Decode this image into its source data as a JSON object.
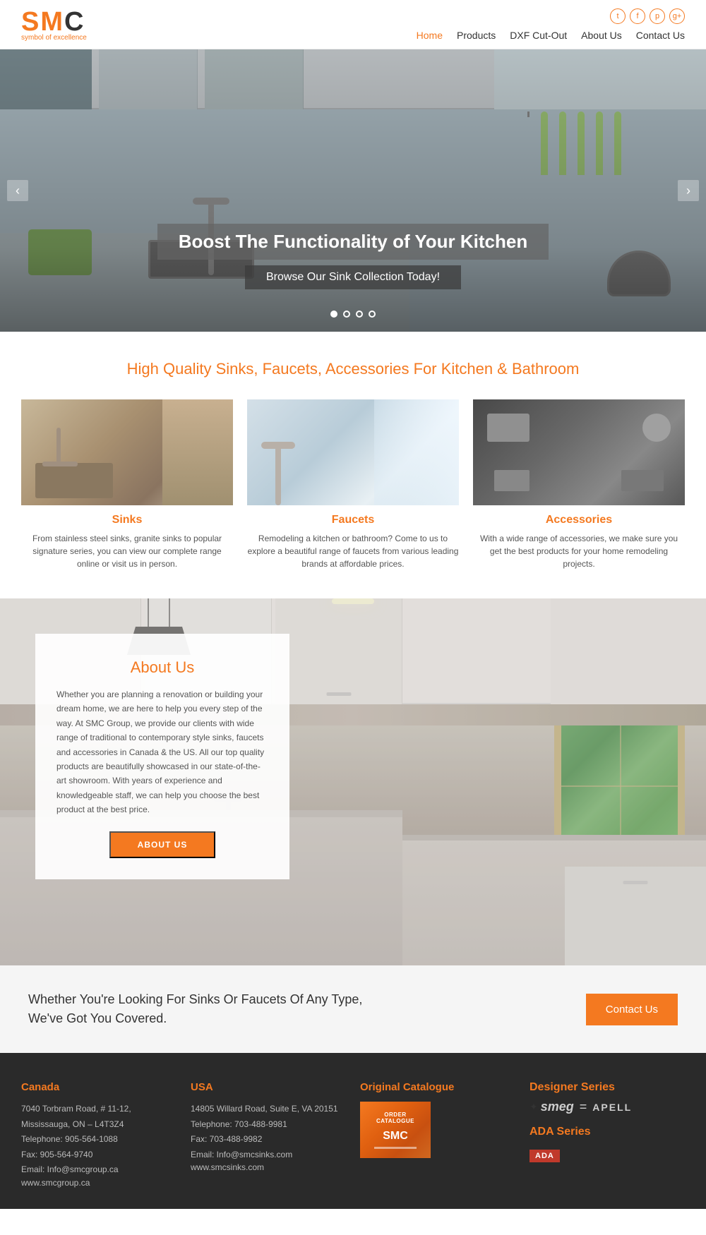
{
  "header": {
    "logo": {
      "main": "SMC",
      "sub": "symbol of excellence"
    },
    "social": {
      "twitter": "t",
      "facebook": "f",
      "pinterest": "p",
      "google": "g+"
    },
    "nav": [
      {
        "label": "Home",
        "active": true
      },
      {
        "label": "Products",
        "active": false
      },
      {
        "label": "DXF Cut-Out",
        "active": false
      },
      {
        "label": "About Us",
        "active": false
      },
      {
        "label": "Contact Us",
        "active": false
      }
    ]
  },
  "hero": {
    "title": "Boost The Functionality of Your Kitchen",
    "subtitle": "Browse Our Sink Collection Today!",
    "dots": [
      true,
      false,
      false,
      false
    ],
    "arrow_left": "‹",
    "arrow_right": "›"
  },
  "quality": {
    "title": "High Quality Sinks, Faucets, Accessories For Kitchen & Bathroom",
    "products": [
      {
        "name": "Sinks",
        "description": "From stainless steel sinks, granite sinks to popular signature series, you can view our complete range online or visit us in person.",
        "image_type": "sinks"
      },
      {
        "name": "Faucets",
        "description": "Remodeling a kitchen or bathroom? Come to us to explore a beautiful range of faucets from various leading brands at affordable prices.",
        "image_type": "faucets"
      },
      {
        "name": "Accessories",
        "description": "With a wide range of accessories, we make sure you get the best products for your home remodeling projects.",
        "image_type": "accessories"
      }
    ]
  },
  "about": {
    "title": "About Us",
    "text": "Whether you are planning a renovation or building your dream home, we are here to help you every step of the way. At SMC Group, we provide our clients with wide range of traditional to contemporary style sinks, faucets and accessories in Canada & the US. All our top quality products are beautifully showcased in our state-of-the-art showroom. With years of experience and knowledgeable staff, we can help you choose the best product at the best price.",
    "button": "ABOUT US"
  },
  "cta": {
    "text": "Whether You're Looking For Sinks Or Faucets Of Any Type, We've Got You Covered.",
    "button": "Contact Us"
  },
  "footer": {
    "canada": {
      "title": "Canada",
      "address": "7040 Torbram Road, # 11-12, Mississauga, ON – L4T3Z4",
      "phone": "Telephone: 905-564-1088",
      "fax": "Fax: 905-564-9740",
      "email": "Email: Info@smcgroup.ca",
      "website": "www.smcgroup.ca"
    },
    "usa": {
      "title": "USA",
      "address": "14805 Willard Road, Suite E, VA 20151",
      "phone": "Telephone: 703-488-9981",
      "fax": "Fax: 703-488-9982",
      "email": "Email: Info@smcsinks.com",
      "website": "www.smcsinks.com"
    },
    "catalogue": {
      "title": "Original Catalogue",
      "image_text": "ORDER CATALOGUE",
      "brand": "SMC"
    },
    "brands": {
      "designer_series": "Designer Series",
      "smeg": "smeg",
      "apell": "APELL",
      "ada_series": "ADA Series",
      "ada_badge": "ADA"
    }
  }
}
